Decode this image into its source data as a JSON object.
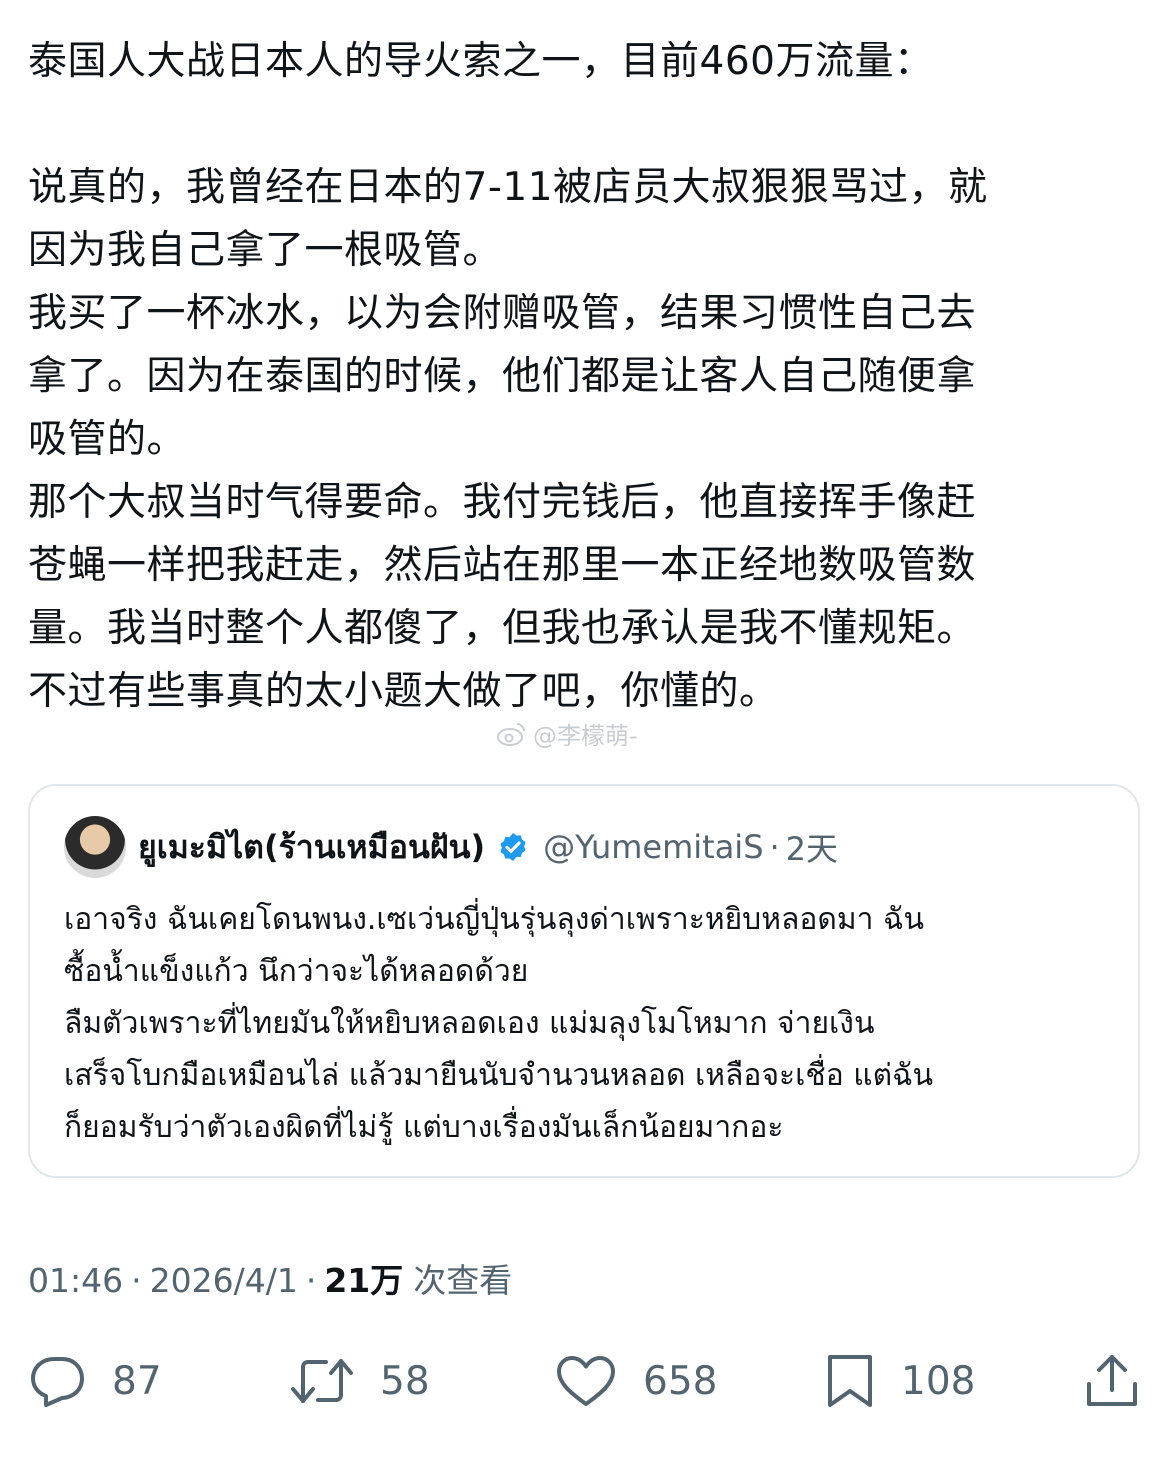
{
  "post": {
    "lines": [
      "泰国人大战日本人的导火索之一，目前460万流量：",
      "",
      "说真的，我曾经在日本的7-11被店员大叔狠狠骂过，就",
      "因为我自己拿了一根吸管。",
      "我买了一杯冰水，以为会附赠吸管，结果习惯性自己去",
      "拿了。因为在泰国的时候，他们都是让客人自己随便拿",
      "吸管的。",
      "那个大叔当时气得要命。我付完钱后，他直接挥手像赶",
      "苍蝇一样把我赶走，然后站在那里一本正经地数吸管数",
      "量。我当时整个人都傻了，但我也承认是我不懂规矩。",
      "不过有些事真的太小题大做了吧，你懂的。"
    ]
  },
  "watermark": {
    "text": "@李檬萌-",
    "icon": "weibo-icon"
  },
  "quote": {
    "author_name": "ยูเมะมิไต(ร้านเหมือนฝัน)",
    "handle": "@YumemitaiS",
    "separator": "·",
    "time": "2天",
    "verified_color": "#1d9bf0",
    "lines": [
      "เอาจริง ฉันเคยโดนพนง.เซเว่นญี่ปุ่นรุ่นลุงด่าเพราะหยิบหลอดมา ฉัน",
      "ซื้อน้ำแข็งแก้ว นึกว่าจะได้หลอดด้วย",
      "ลืมตัวเพราะที่ไทยมันให้หยิบหลอดเอง แม่มลุงโมโหมาก จ่ายเงิน",
      "เสร็จโบกมือเหมือนไล่ แล้วมายืนนับจำนวนหลอด เหลือจะเชื่อ แต่ฉัน",
      "ก็ยอมรับว่าตัวเองผิดที่ไม่รู้ แต่บางเรื่องมันเล็กน้อยมากอะ"
    ]
  },
  "meta": {
    "time": "01:46",
    "sep": "·",
    "date": "2026/4/1",
    "views_count": "21万",
    "views_label": "次查看"
  },
  "actions": {
    "reply_count": "87",
    "retweet_count": "58",
    "like_count": "658",
    "bookmark_count": "108",
    "icon_color": "#536471"
  }
}
